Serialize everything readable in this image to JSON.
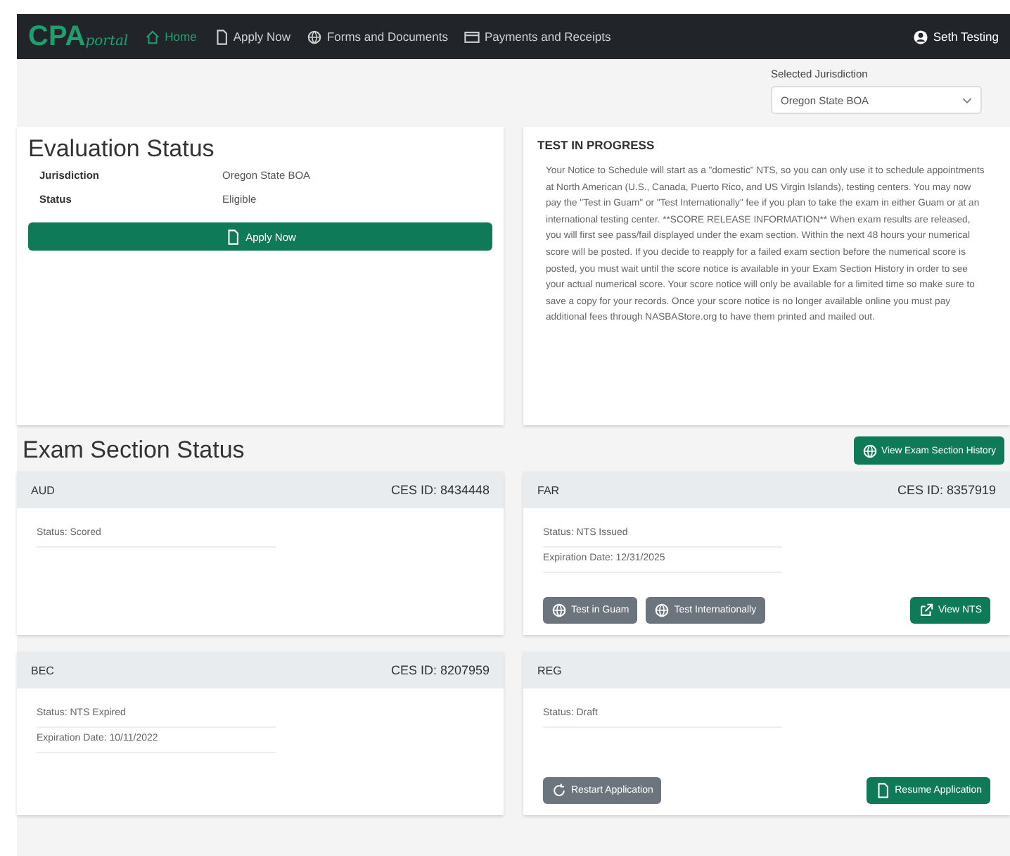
{
  "navbar": {
    "logo_main": "CPA",
    "logo_script": "portal",
    "items": [
      {
        "label": "Home",
        "selected": true
      },
      {
        "label": "Apply Now",
        "selected": false
      },
      {
        "label": "Forms and Documents",
        "selected": false
      },
      {
        "label": "Payments and Receipts",
        "selected": false
      }
    ],
    "user": "Seth Testing"
  },
  "jurisdiction": {
    "label": "Selected Jurisdiction",
    "value": "Oregon State BOA"
  },
  "evaluation": {
    "title": "Evaluation Status",
    "rows": [
      {
        "label": "Jurisdiction",
        "value": "Oregon State BOA"
      },
      {
        "label": "Status",
        "value": "Eligible"
      }
    ],
    "button": "Apply Now"
  },
  "notice": {
    "title": "TEST IN PROGRESS",
    "text": "Your Notice to Schedule will start as a \"domestic\" NTS, so you can only use it to schedule appointments at North American (U.S., Canada, Puerto Rico, and US Virgin Islands), testing centers. You may now pay the \"Test in Guam\" or \"Test Internationally\" fee if you plan to take the exam in either Guam or at an international testing center. **SCORE RELEASE INFORMATION** When exam results are released, you will first see pass/fail displayed under the exam section. Within the next 48 hours your numerical score will be posted. If you decide to reapply for a failed exam section before the numerical score is posted, you must wait until the score notice is available in your Exam Section History in order to see your actual numerical score. Your score notice will only be available for a limited time so make sure to save a copy for your records. Once your score notice is no longer available online you must pay additional fees through NASBAStore.org to have them printed and mailed out."
  },
  "exam": {
    "title": "Exam Section Status",
    "history_button": "View Exam Section History",
    "sections": [
      {
        "code": "AUD",
        "ces_id": "CES ID: 8434448",
        "lines": [
          "Status: Scored"
        ]
      },
      {
        "code": "FAR",
        "ces_id": "CES ID: 8357919",
        "lines": [
          "Status: NTS Issued",
          "Expiration Date: 12/31/2025"
        ],
        "buttons": [
          {
            "label": "Test in Guam",
            "kind": "region"
          },
          {
            "label": "Test Internationally",
            "kind": "region"
          },
          {
            "label": "View NTS",
            "kind": "view"
          }
        ]
      },
      {
        "code": "BEC",
        "ces_id": "CES ID: 8207959",
        "lines": [
          "Status: NTS Expired",
          "Expiration Date: 10/11/2022"
        ]
      },
      {
        "code": "REG",
        "lines": [
          "Status: Draft"
        ],
        "buttons": [
          {
            "label": "Restart Application",
            "kind": "restart"
          },
          {
            "label": "Resume Application",
            "kind": "resume"
          }
        ]
      }
    ]
  }
}
